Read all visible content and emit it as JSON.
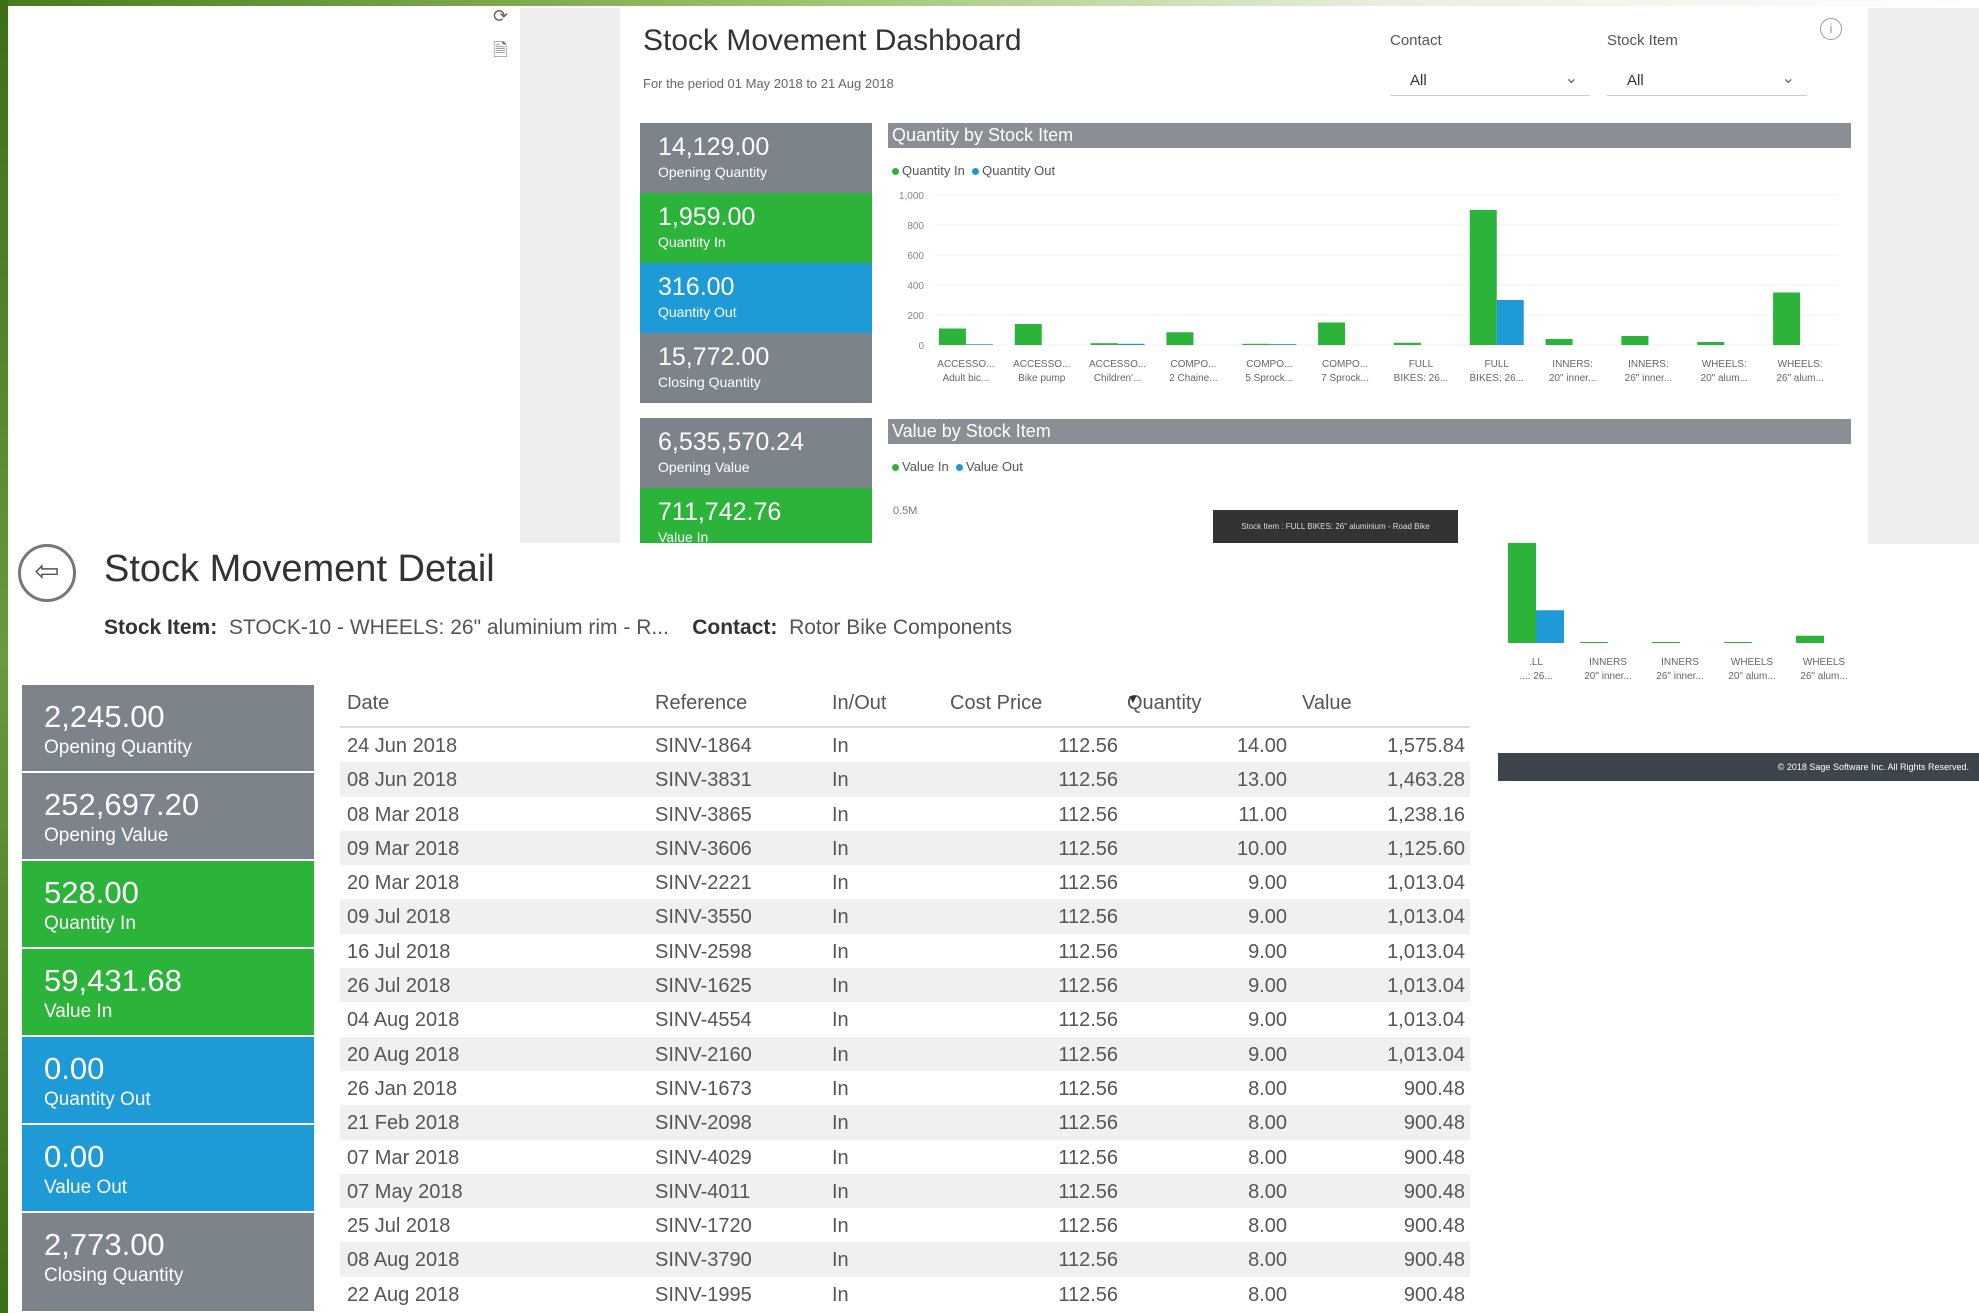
{
  "dashboard": {
    "title": "Stock Movement Dashboard",
    "period": "For the period 01 May 2018 to 21 Aug 2018",
    "filters": {
      "contact_label": "Contact",
      "contact_value": "All",
      "stock_item_label": "Stock Item",
      "stock_item_value": "All"
    },
    "kpis": [
      {
        "value": "14,129.00",
        "label": "Opening Quantity"
      },
      {
        "value": "1,959.00",
        "label": "Quantity In"
      },
      {
        "value": "316.00",
        "label": "Quantity Out"
      },
      {
        "value": "15,772.00",
        "label": "Closing Quantity"
      },
      {
        "value": "6,535,570.24",
        "label": "Opening Value"
      },
      {
        "value": "711,742.76",
        "label": "Value In"
      }
    ],
    "qty_chart_title": "Quantity by Stock Item",
    "qty_legend": [
      "Quantity In",
      "Quantity Out"
    ],
    "value_chart_title": "Value by Stock Item",
    "value_legend": [
      "Value In",
      "Value Out"
    ],
    "value_axis_label": "0.5M",
    "tooltip": "Stock Item : FULL BIKES: 26\" aluminium - Road Bike",
    "footer": "© 2018 Sage Software Inc. All Rights Reserved.",
    "colors": {
      "in": "#2bb33a",
      "out": "#1e9bd7",
      "grey": "#7d838b"
    }
  },
  "chart_data": [
    {
      "type": "bar",
      "title": "Quantity by Stock Item",
      "categories": [
        "ACCESSO... Adult bic...",
        "ACCESSO... Bike pump",
        "ACCESSO... Children'...",
        "COMPO... 2 Chaine...",
        "COMPO... 5 Sprock...",
        "COMPO... 7 Sprock...",
        "FULL BIKES: 26...",
        "FULL BIKES: 26...",
        "INNERS: 20\" inner...",
        "INNERS: 26\" inner...",
        "WHEELS: 20\" alum...",
        "WHEELS: 26\" alum..."
      ],
      "series": [
        {
          "name": "Quantity In",
          "values": [
            110,
            140,
            12,
            85,
            8,
            150,
            15,
            900,
            40,
            60,
            20,
            350
          ]
        },
        {
          "name": "Quantity Out",
          "values": [
            5,
            0,
            8,
            0,
            6,
            0,
            0,
            300,
            0,
            0,
            0,
            0
          ]
        }
      ],
      "yticks": [
        "1,000",
        "800",
        "600",
        "400",
        "200",
        "0"
      ],
      "ylim": [
        0,
        1000
      ]
    },
    {
      "type": "bar",
      "title": "Value by Stock Item",
      "categories": [
        "FULL BIKES: 26...",
        "INNERS: 20\" inner...",
        "INNERS: 26\" inner...",
        "WHEELS: 20\" alum...",
        "WHEELS: 26\" alum..."
      ],
      "tick_labels": [
        ".LL ...: 26...",
        "INNERS 20\" inner...",
        "INNERS 26\" inner...",
        "WHEELS 20\" alum...",
        "WHEELS 26\" alum..."
      ],
      "series": [
        {
          "name": "Value In",
          "values": [
            0.55,
            0.002,
            0.002,
            0.002,
            0.04
          ]
        },
        {
          "name": "Value Out",
          "values": [
            0.18,
            0,
            0,
            0,
            0
          ]
        }
      ],
      "ylabel": "0.5M"
    }
  ],
  "detail": {
    "title": "Stock Movement Detail",
    "stock_item_label": "Stock Item:",
    "stock_item_value": "STOCK-10 - WHEELS: 26\" aluminium rim - R...",
    "contact_label": "Contact:",
    "contact_value": "Rotor Bike Components",
    "kpis": [
      {
        "value": "2,245.00",
        "label": "Opening Quantity"
      },
      {
        "value": "252,697.20",
        "label": "Opening Value"
      },
      {
        "value": "528.00",
        "label": "Quantity In"
      },
      {
        "value": "59,431.68",
        "label": "Value In"
      },
      {
        "value": "0.00",
        "label": "Quantity Out"
      },
      {
        "value": "0.00",
        "label": "Value Out"
      },
      {
        "value": "2,773.00",
        "label": "Closing Quantity"
      }
    ],
    "columns": [
      "Date",
      "Reference",
      "In/Out",
      "Cost Price",
      "Quantity",
      "Value"
    ],
    "rows": [
      [
        "24 Jun 2018",
        "SINV-1864",
        "In",
        "112.56",
        "14.00",
        "1,575.84"
      ],
      [
        "08 Jun 2018",
        "SINV-3831",
        "In",
        "112.56",
        "13.00",
        "1,463.28"
      ],
      [
        "08 Mar 2018",
        "SINV-3865",
        "In",
        "112.56",
        "11.00",
        "1,238.16"
      ],
      [
        "09 Mar 2018",
        "SINV-3606",
        "In",
        "112.56",
        "10.00",
        "1,125.60"
      ],
      [
        "20 Mar 2018",
        "SINV-2221",
        "In",
        "112.56",
        "9.00",
        "1,013.04"
      ],
      [
        "09 Jul 2018",
        "SINV-3550",
        "In",
        "112.56",
        "9.00",
        "1,013.04"
      ],
      [
        "16 Jul 2018",
        "SINV-2598",
        "In",
        "112.56",
        "9.00",
        "1,013.04"
      ],
      [
        "26 Jul 2018",
        "SINV-1625",
        "In",
        "112.56",
        "9.00",
        "1,013.04"
      ],
      [
        "04 Aug 2018",
        "SINV-4554",
        "In",
        "112.56",
        "9.00",
        "1,013.04"
      ],
      [
        "20 Aug 2018",
        "SINV-2160",
        "In",
        "112.56",
        "9.00",
        "1,013.04"
      ],
      [
        "26 Jan 2018",
        "SINV-1673",
        "In",
        "112.56",
        "8.00",
        "900.48"
      ],
      [
        "21 Feb 2018",
        "SINV-2098",
        "In",
        "112.56",
        "8.00",
        "900.48"
      ],
      [
        "07 Mar 2018",
        "SINV-4029",
        "In",
        "112.56",
        "8.00",
        "900.48"
      ],
      [
        "07 May 2018",
        "SINV-4011",
        "In",
        "112.56",
        "8.00",
        "900.48"
      ],
      [
        "25 Jul 2018",
        "SINV-1720",
        "In",
        "112.56",
        "8.00",
        "900.48"
      ],
      [
        "08 Aug 2018",
        "SINV-3790",
        "In",
        "112.56",
        "8.00",
        "900.48"
      ],
      [
        "22 Aug 2018",
        "SINV-1995",
        "In",
        "112.56",
        "8.00",
        "900.48"
      ]
    ]
  }
}
